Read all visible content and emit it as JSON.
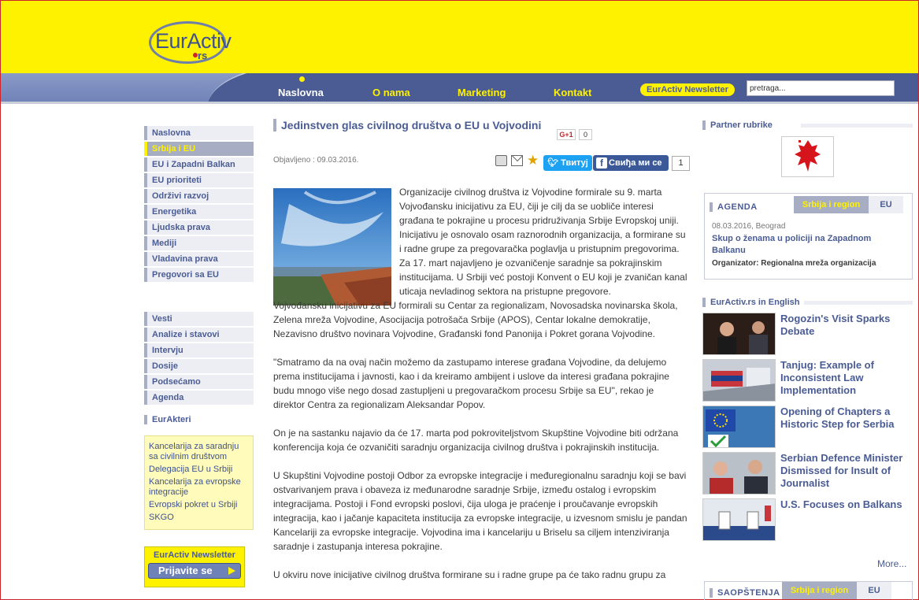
{
  "brand": {
    "logo_text": "EurActiv",
    "logo_suffix": "rs"
  },
  "nav": {
    "items": [
      {
        "label": "Naslovna",
        "active": true
      },
      {
        "label": "O nama",
        "active": false
      },
      {
        "label": "Marketing",
        "active": false
      },
      {
        "label": "Kontakt",
        "active": false
      }
    ],
    "newsletter_label": "EurActiv Newsletter",
    "search_value": "pretraga..."
  },
  "sidebar": {
    "menu1": [
      "Naslovna",
      "Srbija i EU",
      "EU i Zapadni Balkan",
      "EU prioriteti",
      "Održivi razvoj",
      "Energetika",
      "Ljudska prava",
      "Mediji",
      "Vladavina prava",
      "Pregovori sa EU"
    ],
    "menu2": [
      "Vesti",
      "Analize i stavovi",
      "Intervju",
      "Dosije",
      "Podsećamo",
      "Agenda"
    ],
    "akteri_title": "EurAkteri",
    "akteri_links": [
      "Kancelarija za saradnju sa civilnim društvom",
      "Delegacija EU u Srbiji",
      "Kancelarija za evropske integracije",
      "Evropski pokret u Srbiji",
      "SKGO"
    ],
    "newsletter_title": "EurActiv Newsletter",
    "newsletter_button": "Prijavite se"
  },
  "article": {
    "title": "Jedinstven glas civilnog društva o EU u Vojvodini",
    "gplus_label": "G+1",
    "gplus_count": "0",
    "published": "Objavljeno : 09.03.2016.",
    "tweet_label": "Твитуј",
    "fb_label": "Свиђа ми се",
    "fb_count": "1",
    "paragraphs": [
      "Organizacije civilnog društva iz Vojvodine formirale su 9. marta Vojvođansku inicijativu za EU, čiji je cilj da se uobličе interesi građana te pokrajine u procesu pridruživanja Srbije Evropskoj uniji. Inicijativu je osnovalo osam raznorodnih organizacija, a formirane su i radne grupe za pregovaračka poglavlja u pristupnim pregovorima. Za 17. mart najavljeno je ozvaničenje saradnje sa pokrajinskim institucijama. U Srbiji već postoji Konvent o EU koji je zvaničan kanal uticaja nevladinog sektora na pristupne pregovore.",
      "Vojvođansku inicijativu za EU formirali su Centar za regionalizam, Novosadska novinarska škola, Zelena mreža Vojvodine, Asocijacija potrošača Srbije (APOS), Centar lokalne demokratije, Nezavisno društvo novinara Vojvodine, Građanski fond Panonija i Pokret gorana Vojvodine.",
      "\"Smatramo da na ovaj način možemo da zastupamo interese građana Vojvodine, da delujemo prema institucijama i javnosti, kao i da kreiramo ambijent i uslove da interesi građana pokrajine budu mnogo više nego dosad zastupljeni u pregovaračkom procesu Srbije sa EU\", rekao je direktor Centra za regionalizam Aleksandar Popov.",
      "On je na sastanku najavio da će 17. marta pod pokroviteljstvom Skupštine Vojvodine biti održana konferencija koja će ozvaničiti saradnju organizacija civilnog društva i pokrajinskih institucija.",
      "U Skupštini Vojvodine postoji Odbor za evropske integracije i međuregionalnu saradnju koji se bavi ostvarivanjem prava i obaveza iz međunarodne saradnje Srbije, između ostalog i evropskim integracijama. Postoji i Fond evropski poslovi, čija uloga je praćenje i proučavanje evropskih integracija, kao i jačanje kapaciteta institucija za evropske integracije, u izvesnom smislu je pandan Kancelariji za evropske integracije. Vojvodina ima i kancelariju u Briselu sa ciljem intenziviranja saradnje i zastupanja interesa pokrajine.",
      "U okviru nove inicijative civilnog društva formirane su i radne grupe pa će tako radnu grupu za"
    ]
  },
  "right": {
    "partner_label": "Partner rubrike",
    "agenda": {
      "title": "AGENDA",
      "tab_active": "Srbija i region",
      "tab_other": "EU",
      "date": "08.03.2016, Beograd",
      "event_title": "Skup o ženama u policiji na Zapadnom Balkanu",
      "organizer": "Organizator: Regionalna mreža organizacija"
    },
    "english_label": "EurActiv.rs in English",
    "news": [
      "Rogozin's Visit Sparks Debate",
      "Tanjug: Example of Inconsistent Law Implementation",
      "Opening of Chapters a Historic Step for Serbia",
      "Serbian Defence Minister Dismissed for Insult of Journalist",
      "U.S. Focuses on Balkans"
    ],
    "more_label": "More...",
    "saopstenja": {
      "title": "SAOPŠTENJA",
      "tab_active": "Srbija i region",
      "tab_other": "EU"
    }
  },
  "colors": {
    "brand_yellow": "#fff200",
    "brand_blue": "#4a5c93",
    "accent_red": "#c9252b"
  }
}
